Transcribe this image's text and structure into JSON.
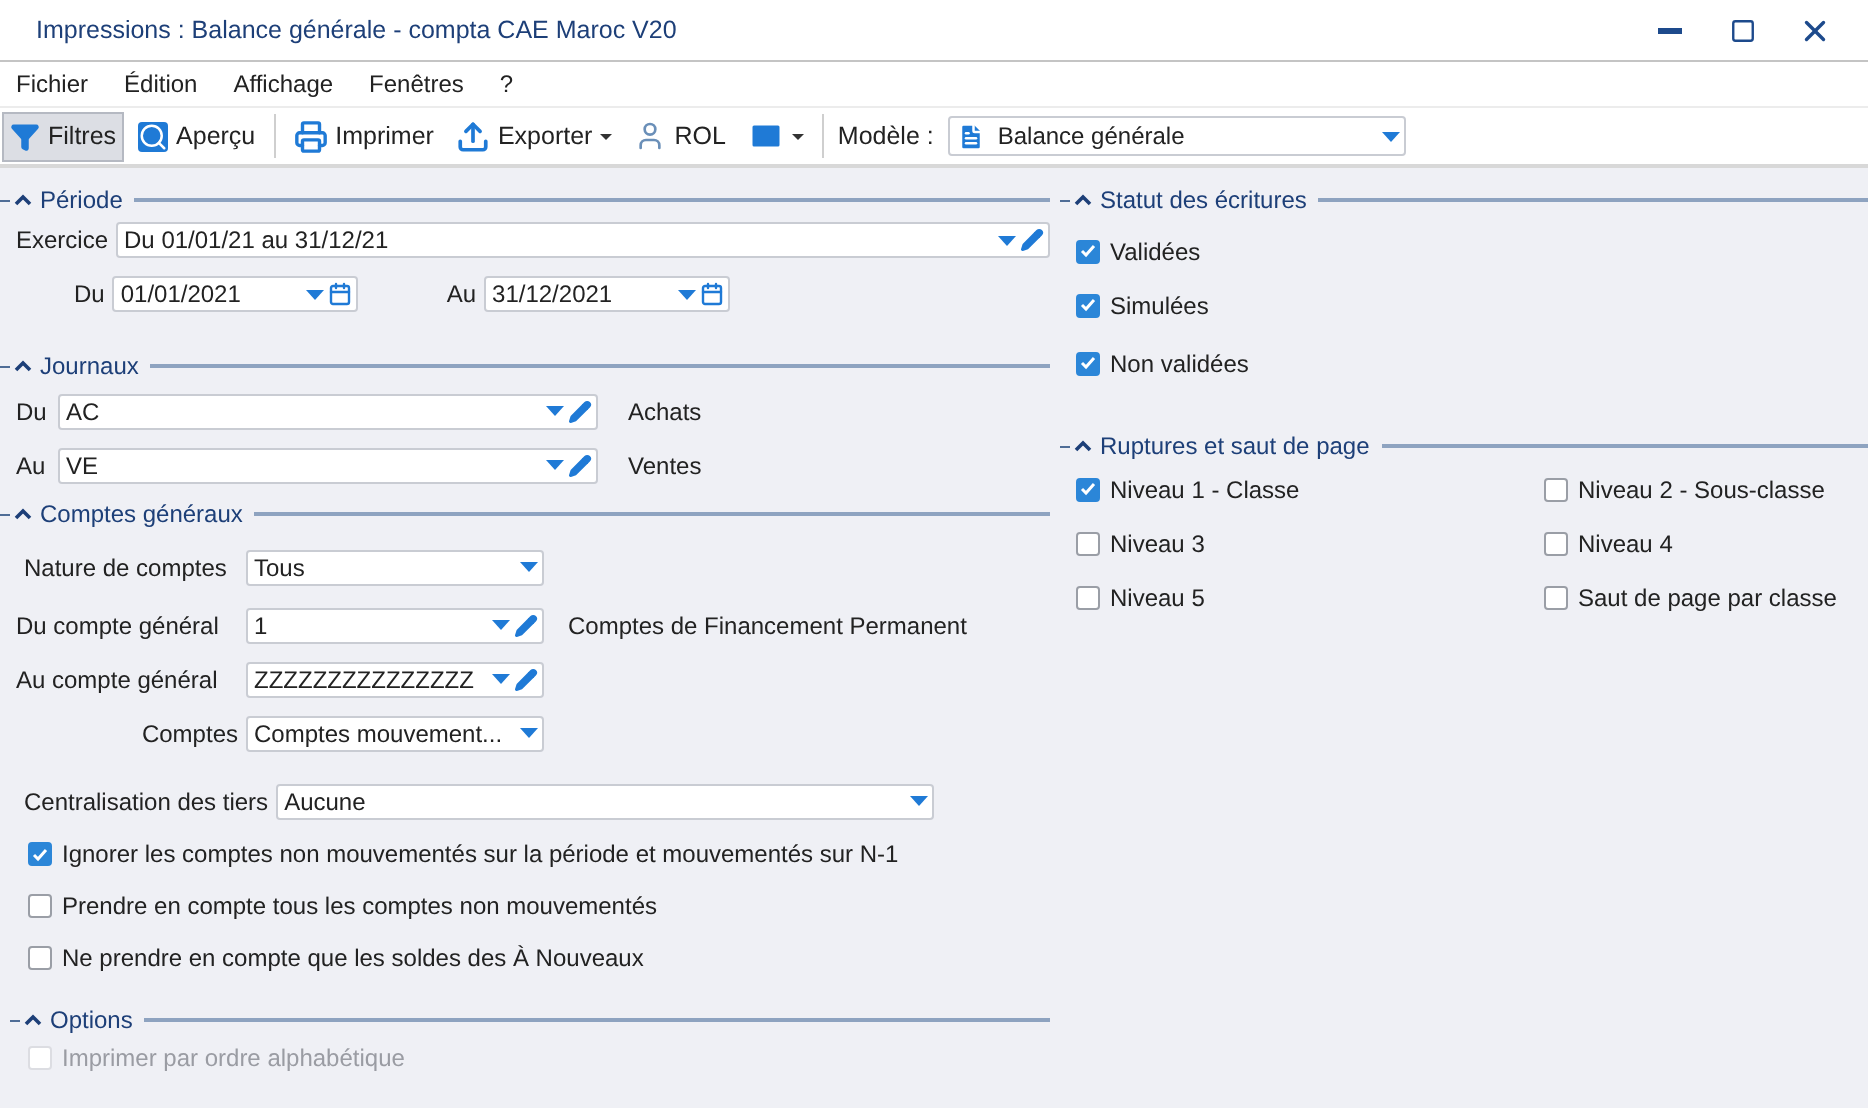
{
  "window": {
    "title": "Impressions : Balance générale - compta CAE Maroc V20"
  },
  "menu": [
    "Fichier",
    "Édition",
    "Affichage",
    "Fenêtres",
    "?"
  ],
  "toolbar": {
    "buttons": [
      {
        "label": "Filtres",
        "selected": true,
        "has_menu": false
      },
      {
        "label": "Aperçu",
        "selected": false,
        "has_menu": false
      },
      {
        "label": "Imprimer",
        "selected": false,
        "has_menu": false
      },
      {
        "label": "Exporter",
        "selected": false,
        "has_menu": true
      },
      {
        "label": "ROL",
        "selected": false,
        "has_menu": false
      },
      {
        "selected": false,
        "has_menu": true
      }
    ],
    "model": {
      "label": "Modèle :",
      "value": "Balance générale"
    }
  },
  "periode": {
    "title": "Période",
    "expanded": true,
    "exercice": {
      "label": "Exercice",
      "value": "Du 01/01/21 au 31/12/21"
    },
    "du": {
      "label": "Du",
      "value": "01/01/2021"
    },
    "au": {
      "label": "Au",
      "value": "31/12/2021"
    }
  },
  "journaux": {
    "title": "Journaux",
    "expanded": true,
    "rows": [
      {
        "label": "Du",
        "value": "AC",
        "caption": "Achats"
      },
      {
        "label": "Au",
        "value": "VE",
        "caption": "Ventes"
      }
    ]
  },
  "comptes_generaux": {
    "title": "Comptes généraux",
    "expanded": true,
    "nature": {
      "label": "Nature de comptes",
      "value": "Tous"
    },
    "du_compte": {
      "label": "Du compte général",
      "value": "1",
      "caption": "Comptes de Financement Permanent"
    },
    "au_compte": {
      "label": "Au compte général",
      "value": "ZZZZZZZZZZZZZZZ"
    },
    "comptes": {
      "label": "Comptes",
      "value": "Comptes mouvement..."
    },
    "centralisation": {
      "label": "Centralisation des tiers",
      "value": "Aucune"
    },
    "checks": [
      {
        "label": "Ignorer les comptes non mouvementés sur la période et mouvementés sur N-1",
        "checked": true,
        "disabled": false
      },
      {
        "label": "Prendre en compte tous les comptes non mouvementés",
        "checked": false,
        "disabled": false
      },
      {
        "label": "Ne prendre en compte que les soldes des À Nouveaux",
        "checked": false,
        "disabled": false
      }
    ]
  },
  "options": {
    "title": "Options",
    "expanded": true,
    "checks": [
      {
        "label": "Imprimer par ordre alphabétique",
        "checked": false,
        "disabled": true
      }
    ]
  },
  "statut": {
    "title": "Statut des écritures",
    "expanded": true,
    "checks": [
      {
        "label": "Validées",
        "checked": true,
        "disabled": false
      },
      {
        "label": "Simulées",
        "checked": true,
        "disabled": false
      },
      {
        "label": "Non validées",
        "checked": true,
        "disabled": false
      }
    ]
  },
  "ruptures": {
    "title": "Ruptures et saut de page",
    "expanded": true,
    "checks": [
      {
        "label": "Niveau 1 - Classe",
        "checked": true,
        "disabled": false
      },
      {
        "label": "Niveau 2 - Sous-classe",
        "checked": false,
        "disabled": false
      },
      {
        "label": "Niveau 3",
        "checked": false,
        "disabled": false
      },
      {
        "label": "Niveau 4",
        "checked": false,
        "disabled": false
      },
      {
        "label": "Niveau 5",
        "checked": false,
        "disabled": false
      },
      {
        "label": "Saut de page par classe",
        "checked": false,
        "disabled": false
      }
    ]
  }
}
